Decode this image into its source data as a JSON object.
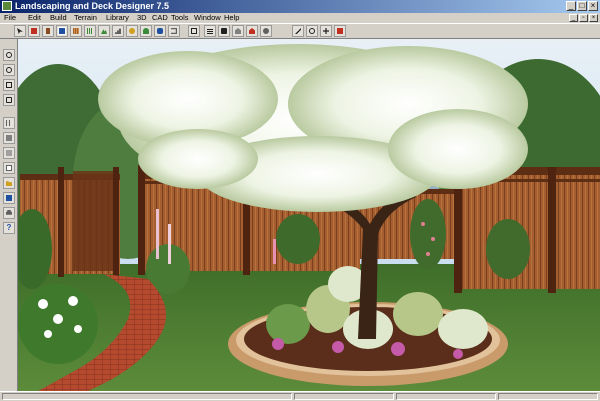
{
  "window": {
    "title": "Landscaping and Deck Designer 7.5",
    "minimize_glyph": "_",
    "maximize_glyph": "□",
    "close_glyph": "×"
  },
  "menu": {
    "items": [
      "File",
      "Edit",
      "Build",
      "Terrain",
      "Library",
      "3D",
      "CAD",
      "Tools",
      "Window",
      "Help"
    ]
  },
  "mdi_controls": {
    "minimize_glyph": "_",
    "restore_glyph": "▫",
    "close_glyph": "×"
  },
  "toolbar": {
    "buttons": [
      "select-arrow-icon",
      "wall-tool-icon",
      "door-tool-icon",
      "window-tool-icon",
      "deck-tool-icon",
      "fence-tool-icon",
      "terrain-tool-icon",
      "stairs-tool-icon",
      "path-tool-icon",
      "plant-tool-icon",
      "paint-tool-icon",
      "library-icon",
      "edit-tool-icon",
      "plan-view-icon",
      "camera-view-icon",
      "elevation-view-icon",
      "perspective-view-icon",
      "render-view-icon",
      "walkthrough-icon",
      "orbit-icon",
      "pan-icon",
      "zoom-camera-icon"
    ],
    "colors": {
      "red": "#c03020",
      "green": "#3a8a3a",
      "blue": "#2050a0",
      "yellow": "#d0a020",
      "gray": "#606060"
    }
  },
  "sidebar": {
    "buttons": [
      "zoom-in-icon",
      "zoom-out-icon",
      "zoom-box-icon",
      "zoom-fit-icon",
      "grid-view-icon",
      "fill-window-icon",
      "refresh-icon",
      "new-document-icon",
      "open-folder-icon",
      "save-icon",
      "print-icon",
      "help-icon"
    ]
  },
  "scene": {
    "sky": "#cfe4f4",
    "lawn": "#4f7f33",
    "fence": "#9a5a30",
    "blossom": "#f4f8ee",
    "brick": "#b05030"
  }
}
